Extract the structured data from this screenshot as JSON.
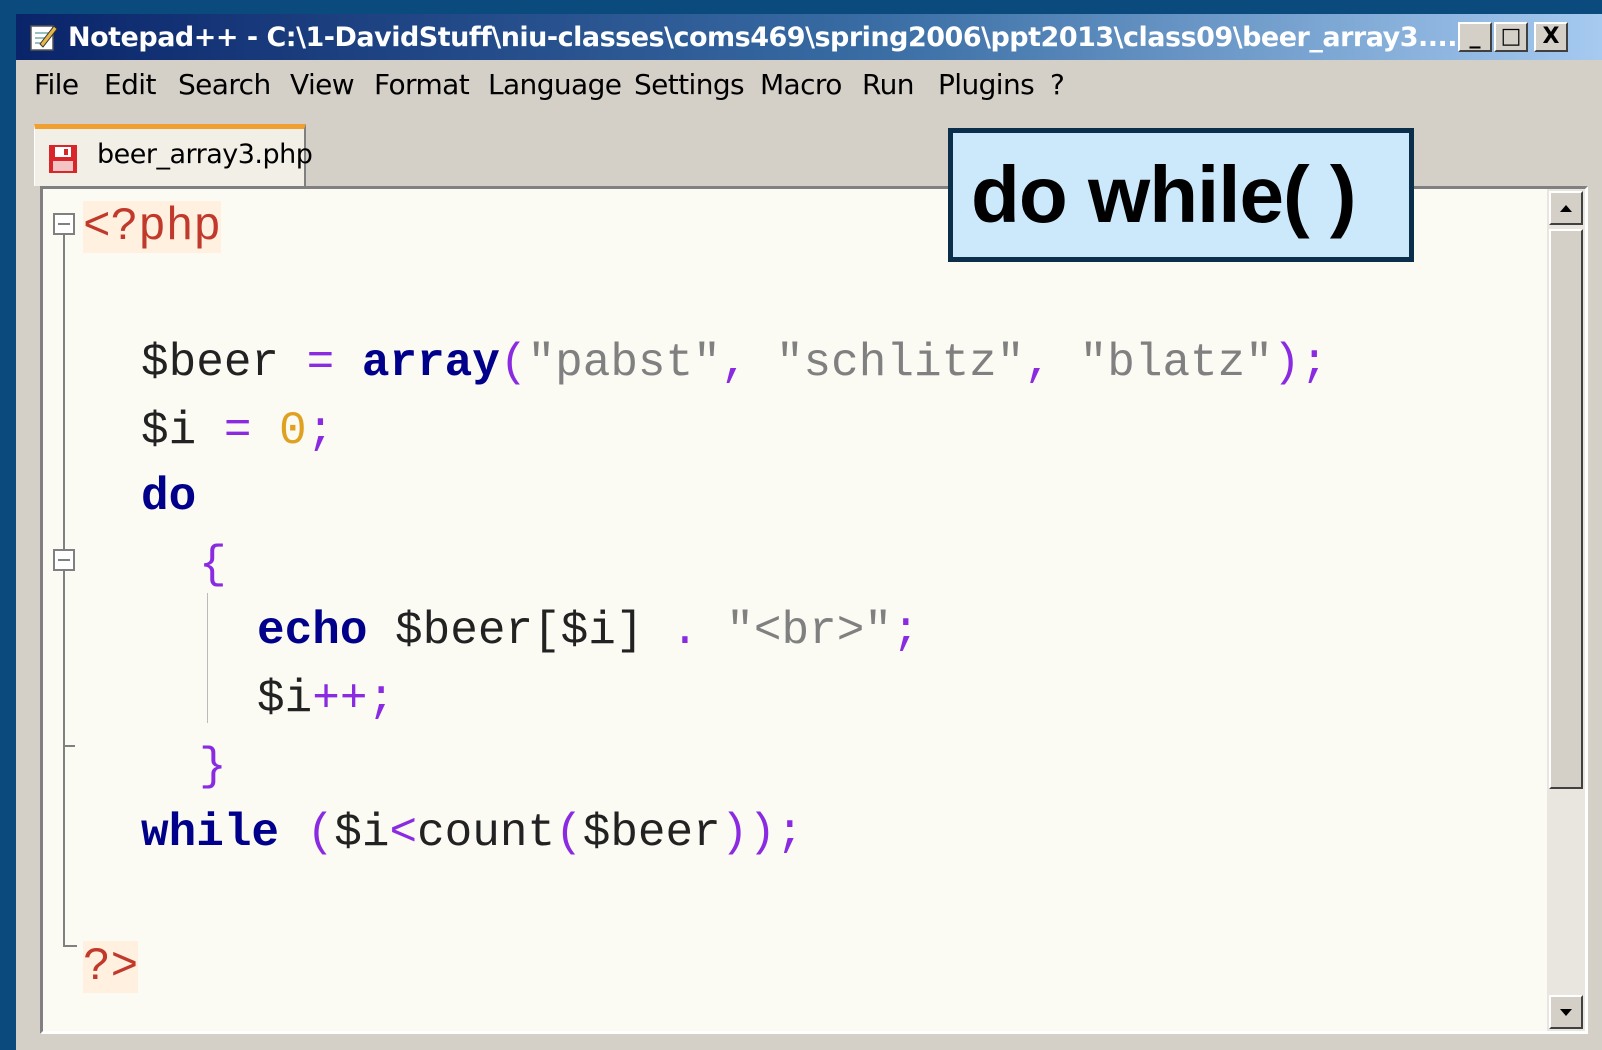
{
  "window": {
    "title": "Notepad++ - C:\\1-DavidStuff\\niu-classes\\coms469\\spring2006\\ppt2013\\class09\\beer_array3....",
    "minimize": "_",
    "maximize": "□",
    "close": "X"
  },
  "menu": [
    "File",
    "Edit",
    "Search",
    "View",
    "Format",
    "Language",
    "Settings",
    "Macro",
    "Run",
    "Plugins",
    "?"
  ],
  "tab": {
    "label": "beer_array3.php"
  },
  "callout": {
    "text": "do while( )"
  },
  "code": {
    "open_tag": "<?php",
    "l1_var": "$beer",
    "l1_eq": " = ",
    "l1_fn": "array",
    "l1_paren_open": "(",
    "l1_s1": "\"pabst\"",
    "l1_c1": ", ",
    "l1_s2": "\"schlitz\"",
    "l1_c2": ", ",
    "l1_s3": "\"blatz\"",
    "l1_end": ");",
    "l2_var": "$i",
    "l2_eq": " = ",
    "l2_num": "0",
    "l2_end": ";",
    "l3_kw": "do",
    "l4_brace": "{",
    "l5_kw": "echo",
    "l5_var": " $beer[$i]",
    "l5_dot": " . ",
    "l5_str": "\"<br>\"",
    "l5_end": ";",
    "l6_var": "$i",
    "l6_op": "++;",
    "l7_brace": "}",
    "l8_kw": "while",
    "l8_rest1": " (",
    "l8_rest2": "$i",
    "l8_rest3": "<",
    "l8_rest4": "count",
    "l8_rest5": "(",
    "l8_rest6": "$beer",
    "l8_rest7": "));",
    "close_tag": "?>"
  },
  "colors": {
    "keyword": "#00008b",
    "string": "#808080",
    "operator": "#8a2be2",
    "number": "#e0a020",
    "php_tag": "#c0392b",
    "callout_bg": "#cce8fb",
    "background": "#0a4a7d"
  }
}
